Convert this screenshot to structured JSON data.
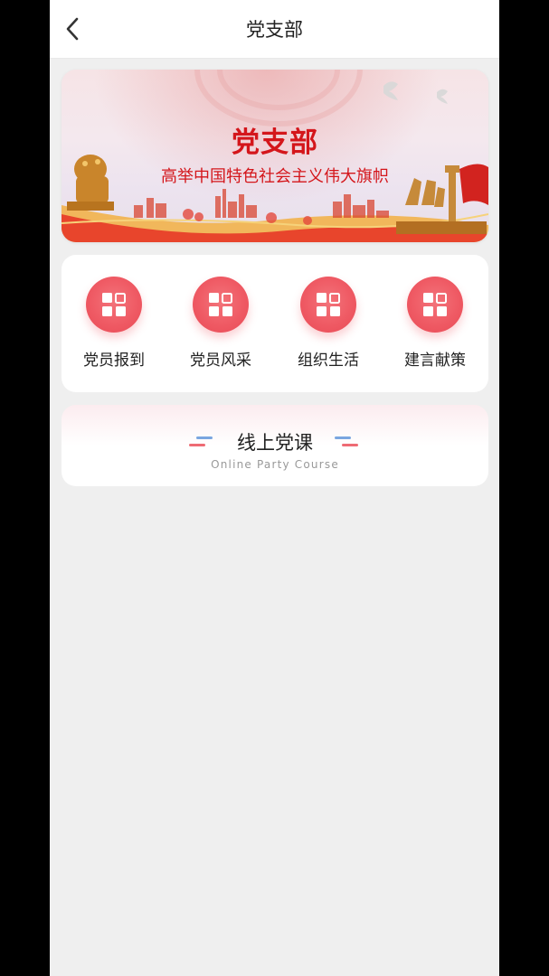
{
  "header": {
    "title": "党支部"
  },
  "banner": {
    "title": "党支部",
    "subtitle": "高举中国特色社会主义伟大旗帜"
  },
  "menu": {
    "items": [
      {
        "label": "党员报到",
        "icon": "grid-icon"
      },
      {
        "label": "党员风采",
        "icon": "grid-icon"
      },
      {
        "label": "组织生活",
        "icon": "grid-icon"
      },
      {
        "label": "建言献策",
        "icon": "grid-icon"
      }
    ]
  },
  "course": {
    "title": "线上党课",
    "subtitle": "Online Party Course"
  },
  "colors": {
    "accent": "#ef5a64",
    "banner_red": "#d4161b",
    "background": "#efefef"
  }
}
